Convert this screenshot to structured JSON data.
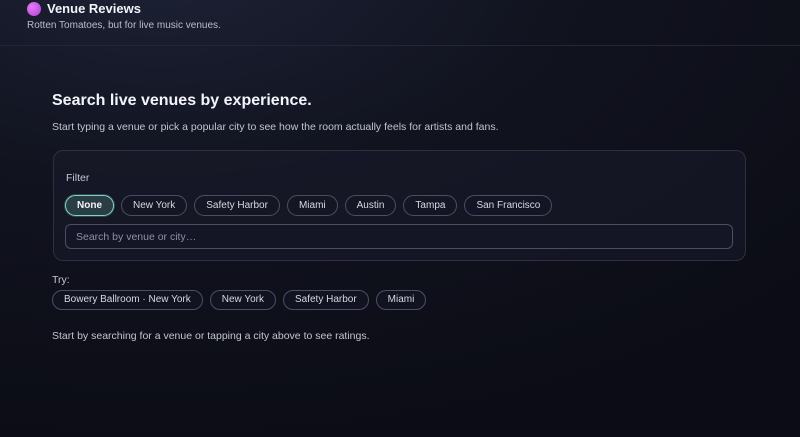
{
  "header": {
    "title": "Venue Reviews",
    "tagline": "Rotten Tomatoes, but for live music venues.",
    "logo_color": "#c24fe0"
  },
  "hero": {
    "title": "Search live venues by experience.",
    "subtitle": "Start typing a venue or pick a popular city to see how the room actually feels for artists and fans."
  },
  "filter": {
    "label": "Filter",
    "selected": "None",
    "options": [
      "None",
      "New York",
      "Safety Harbor",
      "Miami",
      "Austin",
      "Tampa",
      "San Francisco"
    ]
  },
  "search": {
    "placeholder": "Search by venue or city…",
    "value": ""
  },
  "suggestions": {
    "label": "Try:",
    "items": [
      "Bowery Ballroom · New York",
      "New York",
      "Safety Harbor",
      "Miami"
    ]
  },
  "empty_state": "Start by searching for a venue or tapping a city above to see ratings.",
  "colors": {
    "accent": "#7fd3c4",
    "background": "#0f111c"
  }
}
